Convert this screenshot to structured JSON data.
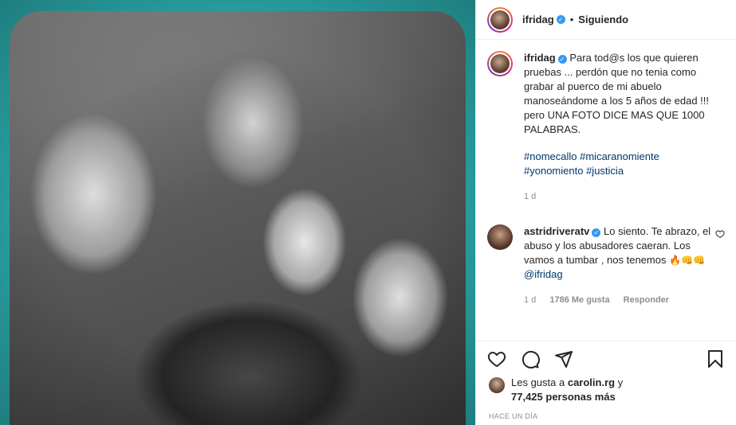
{
  "post": {
    "username": "ifridag",
    "follow_status": "Siguiendo",
    "caption": "Para tod@s los que quieren pruebas ... perdón que no tenia como grabar al puerco de mi abuelo manoseándome a los 5 años de edad !!! pero UNA FOTO DICE MAS QUE 1000 PALABRAS.",
    "hashtags": [
      "#nomecallo",
      "#micaranomiente",
      "#yonomiento",
      "#justicia"
    ],
    "caption_time": "1 d"
  },
  "comment": {
    "username": "astridriveratv",
    "text": "Lo siento. Te abrazo, el abuso y los abusadores caeran. Los vamos a tumbar , nos tenemos",
    "emojis": "🔥👊👊",
    "mention": "@ifridag",
    "time": "1 d",
    "likes": "1786 Me gusta",
    "reply_label": "Responder"
  },
  "likes_line": {
    "prefix": "Les gusta a",
    "user": "carolin.rg",
    "conj": "y",
    "count": "77,425 personas más"
  },
  "timestamp": "HACE UN DÍA",
  "icons": {
    "like": "heart-icon",
    "comment": "comment-icon",
    "share": "share-icon",
    "save": "bookmark-icon"
  },
  "colors": {
    "link": "#00376b",
    "verified": "#3897f0",
    "muted": "#8e8e8e"
  }
}
